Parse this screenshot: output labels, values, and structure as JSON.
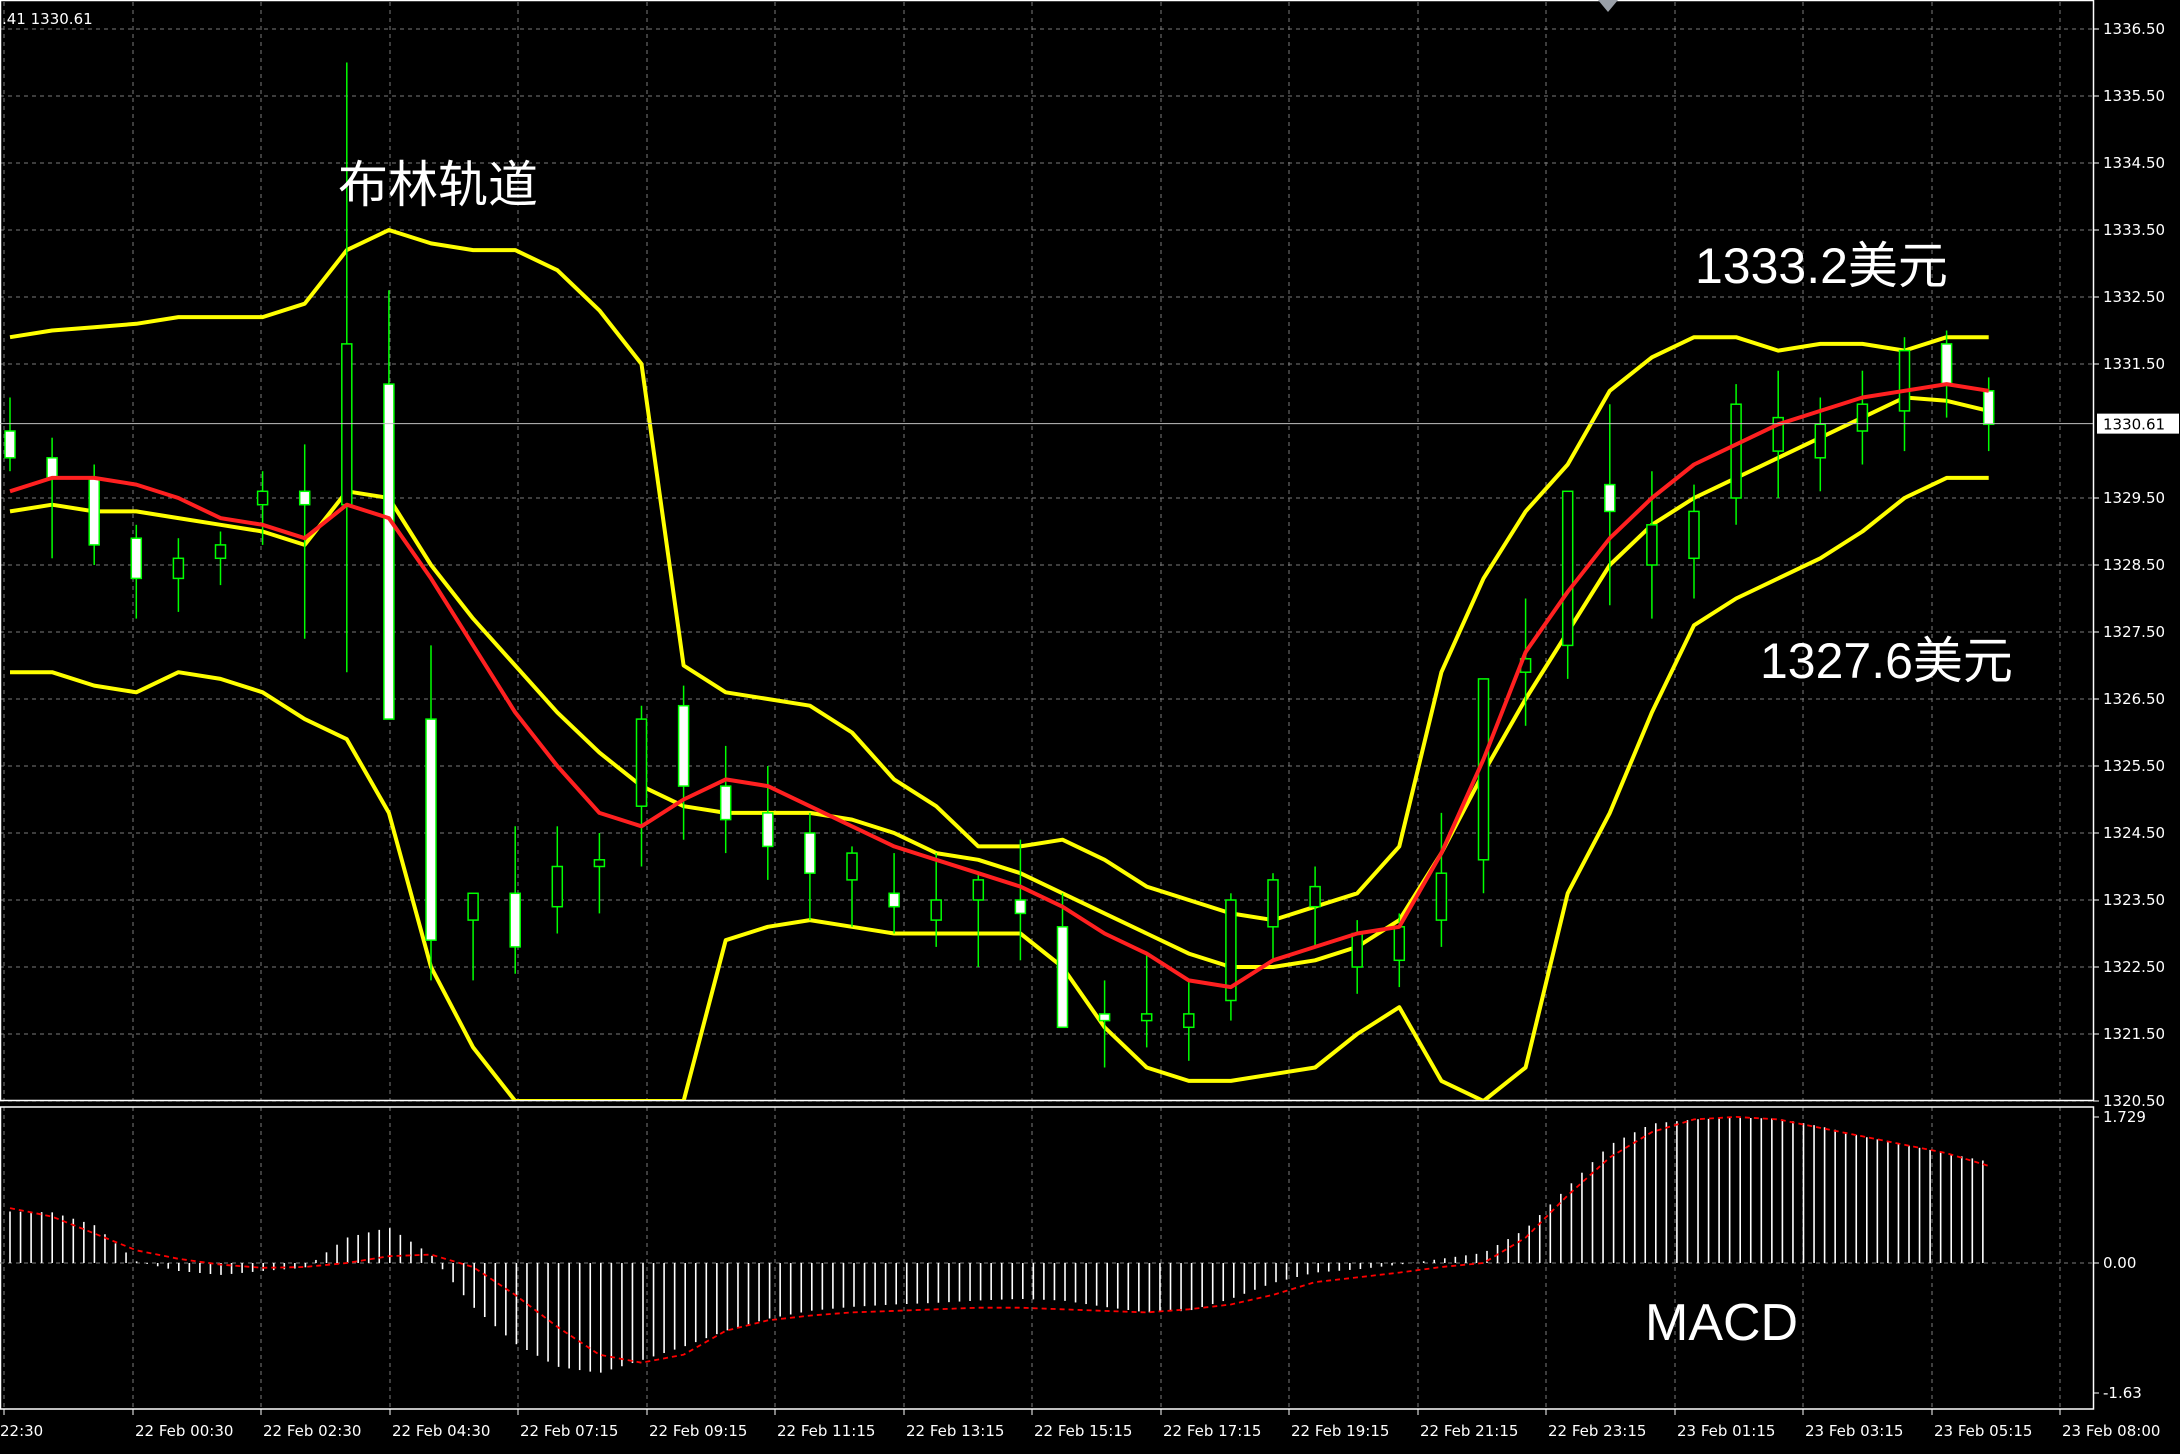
{
  "colors": {
    "background": "#000000",
    "grid": "#7a7a7a",
    "frame": "#ffffff",
    "bull_candle": "#00ff00",
    "bear_candle": "#ffffff",
    "bollinger": "#ffff00",
    "moving_average": "#ff2020",
    "macd_histogram": "#ffffff",
    "macd_signal": "#ff0000",
    "text": "#ffffff"
  },
  "chart_data": [
    {
      "type": "candlestick",
      "header": ".41 1330.61",
      "current_price_label": "1330.61",
      "ylim": [
        1320.5,
        1336.7
      ],
      "y_ticks": [
        "1336.50",
        "1335.50",
        "1334.50",
        "1333.50",
        "1332.50",
        "1331.50",
        "1329.50",
        "1328.50",
        "1327.50",
        "1326.50",
        "1325.50",
        "1324.50",
        "1323.50",
        "1322.50",
        "1321.50",
        "1320.50"
      ],
      "x_ticks": [
        "22:30",
        "22 Feb 00:30",
        "22 Feb 02:30",
        "22 Feb 04:30",
        "22 Feb 07:15",
        "22 Feb 09:15",
        "22 Feb 11:15",
        "22 Feb 13:15",
        "22 Feb 15:15",
        "22 Feb 17:15",
        "22 Feb 19:15",
        "22 Feb 21:15",
        "22 Feb 23:15",
        "23 Feb 01:15",
        "23 Feb 03:15",
        "23 Feb 05:15",
        "23 Feb 08:00"
      ],
      "annotations": {
        "bollinger_label": "布林轨道",
        "upper_price": "1333.2美元",
        "lower_price": "1327.6美元"
      },
      "bollinger_upper": [
        1331.9,
        1332.0,
        1332.05,
        1332.1,
        1332.2,
        1332.2,
        1332.2,
        1332.4,
        1333.2,
        1333.5,
        1333.3,
        1333.2,
        1333.2,
        1332.9,
        1332.3,
        1331.5,
        1327.0,
        1326.6,
        1326.5,
        1326.4,
        1326.0,
        1325.3,
        1324.9,
        1324.3,
        1324.3,
        1324.4,
        1324.1,
        1323.7,
        1323.5,
        1323.3,
        1323.2,
        1323.4,
        1323.6,
        1324.3,
        1326.9,
        1328.3,
        1329.3,
        1330.0,
        1331.1,
        1331.6,
        1331.9,
        1331.9,
        1331.7,
        1331.8,
        1331.8,
        1331.7,
        1331.9,
        1331.9
      ],
      "bollinger_middle": [
        1329.3,
        1329.4,
        1329.3,
        1329.3,
        1329.2,
        1329.1,
        1329.0,
        1328.8,
        1329.6,
        1329.5,
        1328.5,
        1327.7,
        1327.0,
        1326.3,
        1325.7,
        1325.2,
        1324.9,
        1324.8,
        1324.8,
        1324.8,
        1324.7,
        1324.5,
        1324.2,
        1324.1,
        1323.9,
        1323.6,
        1323.3,
        1323.0,
        1322.7,
        1322.5,
        1322.5,
        1322.6,
        1322.8,
        1323.2,
        1324.2,
        1325.4,
        1326.5,
        1327.5,
        1328.5,
        1329.1,
        1329.5,
        1329.8,
        1330.1,
        1330.4,
        1330.7,
        1331.0,
        1330.95,
        1330.8
      ],
      "bollinger_lower": [
        1326.9,
        1326.9,
        1326.7,
        1326.6,
        1326.9,
        1326.8,
        1326.6,
        1326.2,
        1325.9,
        1324.8,
        1322.5,
        1321.3,
        1320.5,
        1320.5,
        1320.5,
        1320.5,
        1320.5,
        1322.9,
        1323.1,
        1323.2,
        1323.1,
        1323.0,
        1323.0,
        1323.0,
        1323.0,
        1322.5,
        1321.6,
        1321.0,
        1320.8,
        1320.8,
        1320.9,
        1321.0,
        1321.5,
        1321.9,
        1320.8,
        1320.5,
        1321.0,
        1323.6,
        1324.8,
        1326.3,
        1327.6,
        1328.0,
        1328.3,
        1328.6,
        1329.0,
        1329.5,
        1329.8,
        1329.8
      ],
      "moving_average": [
        1329.6,
        1329.8,
        1329.8,
        1329.7,
        1329.5,
        1329.2,
        1329.1,
        1328.9,
        1329.4,
        1329.2,
        1328.3,
        1327.3,
        1326.3,
        1325.5,
        1324.8,
        1324.6,
        1325.0,
        1325.3,
        1325.2,
        1324.9,
        1324.6,
        1324.3,
        1324.1,
        1323.9,
        1323.7,
        1323.4,
        1323.0,
        1322.7,
        1322.3,
        1322.2,
        1322.6,
        1322.8,
        1323.0,
        1323.1,
        1324.2,
        1325.6,
        1327.2,
        1328.1,
        1328.9,
        1329.5,
        1330.0,
        1330.3,
        1330.6,
        1330.8,
        1331.0,
        1331.1,
        1331.2,
        1331.1
      ],
      "candles": [
        [
          1330.5,
          1331.0,
          1329.9,
          1330.1
        ],
        [
          1330.1,
          1330.4,
          1328.6,
          1329.8
        ],
        [
          1329.8,
          1330.0,
          1328.5,
          1328.8
        ],
        [
          1328.9,
          1329.1,
          1327.7,
          1328.3
        ],
        [
          1328.3,
          1328.9,
          1327.8,
          1328.6
        ],
        [
          1328.6,
          1329.0,
          1328.2,
          1328.8
        ],
        [
          1329.4,
          1329.9,
          1328.8,
          1329.6
        ],
        [
          1329.6,
          1330.3,
          1327.4,
          1329.4
        ],
        [
          1329.4,
          1336.0,
          1326.9,
          1331.8
        ],
        [
          1331.2,
          1332.6,
          1326.6,
          1326.2
        ],
        [
          1326.2,
          1327.3,
          1322.3,
          1322.9
        ],
        [
          1323.2,
          1323.5,
          1322.3,
          1323.6
        ],
        [
          1323.6,
          1324.6,
          1322.4,
          1322.8
        ],
        [
          1323.4,
          1324.6,
          1323.0,
          1324.0
        ],
        [
          1324.0,
          1324.5,
          1323.3,
          1324.1
        ],
        [
          1324.9,
          1326.4,
          1324.0,
          1326.2
        ],
        [
          1326.4,
          1326.7,
          1324.4,
          1325.2
        ],
        [
          1325.2,
          1325.8,
          1324.2,
          1324.7
        ],
        [
          1324.8,
          1325.5,
          1323.8,
          1324.3
        ],
        [
          1324.5,
          1324.8,
          1323.2,
          1323.9
        ],
        [
          1323.8,
          1324.3,
          1323.1,
          1324.2
        ],
        [
          1323.6,
          1324.2,
          1323.0,
          1323.4
        ],
        [
          1323.2,
          1324.2,
          1322.8,
          1323.5
        ],
        [
          1323.5,
          1323.9,
          1322.5,
          1323.8
        ],
        [
          1323.5,
          1324.4,
          1322.6,
          1323.3
        ],
        [
          1323.1,
          1323.6,
          1321.6,
          1321.6
        ],
        [
          1321.8,
          1322.3,
          1321.0,
          1321.7
        ],
        [
          1321.7,
          1322.7,
          1321.3,
          1321.8
        ],
        [
          1321.6,
          1322.3,
          1321.1,
          1321.8
        ],
        [
          1322.0,
          1323.6,
          1321.7,
          1323.5
        ],
        [
          1323.1,
          1323.9,
          1322.6,
          1323.8
        ],
        [
          1323.4,
          1324.0,
          1322.8,
          1323.7
        ],
        [
          1322.5,
          1323.2,
          1322.1,
          1323.0
        ],
        [
          1322.6,
          1323.3,
          1322.2,
          1323.1
        ],
        [
          1323.2,
          1324.8,
          1322.8,
          1323.9
        ],
        [
          1324.1,
          1325.9,
          1323.6,
          1326.8
        ],
        [
          1326.9,
          1328.0,
          1326.1,
          1327.1
        ],
        [
          1327.3,
          1329.2,
          1326.8,
          1329.6
        ],
        [
          1329.7,
          1330.9,
          1327.9,
          1329.3
        ],
        [
          1328.5,
          1329.9,
          1327.7,
          1329.1
        ],
        [
          1328.6,
          1329.7,
          1328.0,
          1329.3
        ],
        [
          1329.5,
          1331.2,
          1329.1,
          1330.9
        ],
        [
          1330.2,
          1331.4,
          1329.5,
          1330.7
        ],
        [
          1330.1,
          1331.0,
          1329.6,
          1330.6
        ],
        [
          1330.5,
          1331.4,
          1330.0,
          1330.9
        ],
        [
          1330.8,
          1331.9,
          1330.2,
          1331.7
        ],
        [
          1331.8,
          1332.0,
          1330.7,
          1331.2
        ],
        [
          1331.1,
          1331.3,
          1330.2,
          1330.6
        ]
      ]
    },
    {
      "type": "macd",
      "label": "MACD",
      "ylim": [
        -1.63,
        1.729
      ],
      "y_ticks": [
        "1.729",
        "0.00",
        "-1.63"
      ],
      "histogram": [
        0.61,
        0.6,
        0.45,
        0.02,
        -0.1,
        -0.15,
        -0.1,
        -0.06,
        0.3,
        0.42,
        0.1,
        -0.55,
        -1.01,
        -1.3,
        -1.38,
        -1.22,
        -1.05,
        -0.85,
        -0.7,
        -0.6,
        -0.55,
        -0.52,
        -0.5,
        -0.47,
        -0.45,
        -0.47,
        -0.55,
        -0.62,
        -0.6,
        -0.45,
        -0.25,
        -0.12,
        -0.08,
        -0.02,
        0.05,
        0.12,
        0.4,
        0.9,
        1.4,
        1.65,
        1.7,
        1.72,
        1.71,
        1.62,
        1.5,
        1.4,
        1.3,
        1.2
      ],
      "signal": [
        0.65,
        0.55,
        0.35,
        0.15,
        0.05,
        -0.02,
        -0.06,
        -0.05,
        0.0,
        0.08,
        0.1,
        -0.05,
        -0.4,
        -0.8,
        -1.15,
        -1.25,
        -1.15,
        -0.85,
        -0.72,
        -0.66,
        -0.62,
        -0.6,
        -0.58,
        -0.56,
        -0.56,
        -0.58,
        -0.6,
        -0.62,
        -0.58,
        -0.52,
        -0.4,
        -0.24,
        -0.18,
        -0.12,
        -0.05,
        0.0,
        0.3,
        0.8,
        1.25,
        1.55,
        1.7,
        1.73,
        1.7,
        1.6,
        1.5,
        1.4,
        1.3,
        1.15
      ]
    }
  ]
}
